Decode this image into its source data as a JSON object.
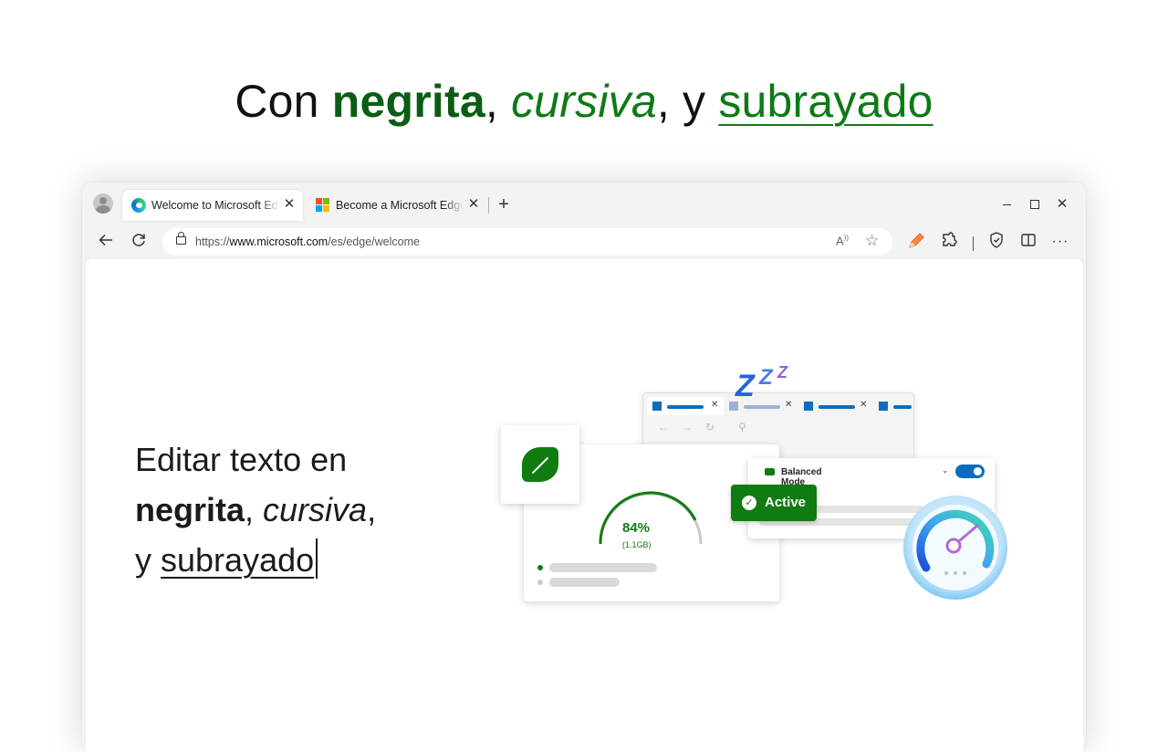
{
  "headline": {
    "prefix": "Con ",
    "bold": "negrita",
    "sep1": ", ",
    "italic": "cursiva",
    "sep2": ", y ",
    "underline": "subrayado"
  },
  "browser": {
    "tabs": [
      {
        "title": "Welcome to Microsoft Edge",
        "icon": "edge-icon",
        "active": true
      },
      {
        "title": "Become a Microsoft Edge Insider",
        "icon": "microsoft-logo-icon",
        "active": false
      }
    ],
    "new_tab_glyph": "+",
    "close_glyph": "✕",
    "address": {
      "scheme": "https://",
      "host": "www.microsoft.com",
      "path": "/es/edge/welcome"
    },
    "toolbar_icons": [
      "back-icon",
      "reload-icon",
      "lock-icon",
      "read-aloud-icon",
      "favorites-star-icon",
      "pen-icon",
      "extensions-icon",
      "browser-essentials-icon",
      "split-screen-icon",
      "more-icon"
    ],
    "window_controls": [
      "minimize-icon",
      "maximize-icon",
      "close-icon"
    ]
  },
  "page": {
    "lead_line1": "Editar texto en",
    "lead_bold": "negrita",
    "lead_sep1": ", ",
    "lead_italic": "cursiva",
    "lead_sep2": ",",
    "lead_y": "y ",
    "lead_underline": "subrayado"
  },
  "illustration": {
    "percent": "84%",
    "memory": "(1.1GB)",
    "mode_label": "Balanced Mode",
    "toggle_on": true,
    "badge": "Active",
    "zzz": "ZZZ",
    "colors": {
      "green": "#107c10",
      "blue": "#0f6cbd"
    }
  }
}
